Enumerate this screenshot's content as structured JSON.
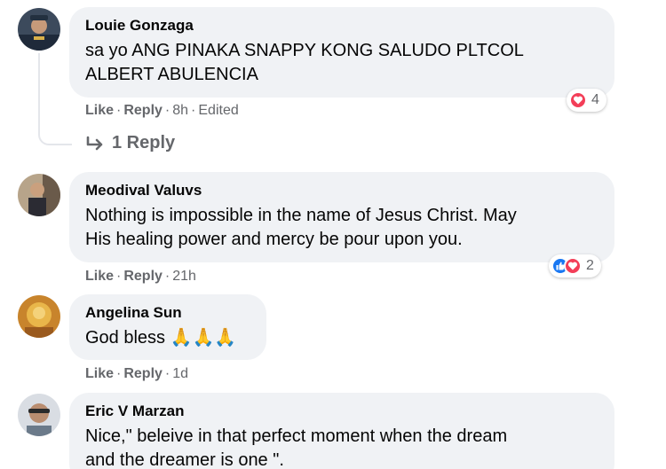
{
  "comments": [
    {
      "author": "Louie Gonzaga",
      "line1": "sa yo ANG PINAKA SNAPPY KONG SALUDO PLTCOL",
      "line2": "ALBERT ABULENCIA",
      "like": "Like",
      "reply": "Reply",
      "time": "8h",
      "edited": "Edited",
      "reaction_count": "4",
      "replies": "1 Reply"
    },
    {
      "author": "Meodival Valuvs",
      "line1": "Nothing is impossible in the name of Jesus Christ. May",
      "line2": "His healing power and mercy be pour upon you.",
      "like": "Like",
      "reply": "Reply",
      "time": "21h",
      "reaction_count": "2"
    },
    {
      "author": "Angelina Sun",
      "line1": "God bless",
      "emoji": "🙏🙏🙏",
      "like": "Like",
      "reply": "Reply",
      "time": "1d"
    },
    {
      "author": "Eric V Marzan",
      "line1": "Nice,\" beleive in that perfect moment when the dream",
      "line2": "and the dreamer is one \"."
    }
  ],
  "separator": "·",
  "colors": {
    "bubble": "#f0f2f5",
    "meta": "#65676b",
    "love": "#f33e58",
    "like": "#1877f2"
  }
}
